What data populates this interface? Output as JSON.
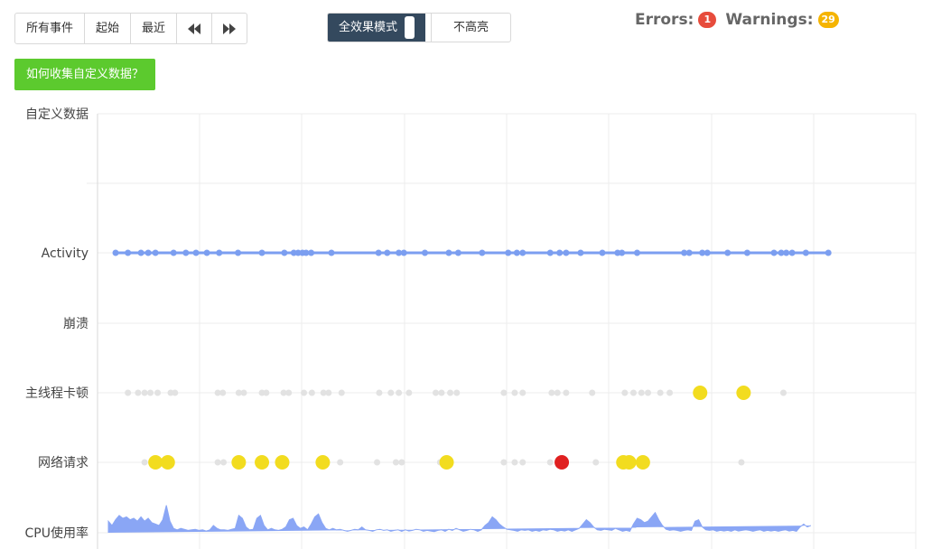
{
  "toolbar": {
    "all_events": "所有事件",
    "start": "起始",
    "recent": "最近",
    "prev_icon": "double-left-icon",
    "next_icon": "double-right-icon"
  },
  "mode_toggle": {
    "on_label": "全效果模式",
    "off_label": "不高亮"
  },
  "status": {
    "errors_label": "Errors:",
    "errors_count": "1",
    "warnings_label": "Warnings:",
    "warnings_count": "29"
  },
  "help_button": "如何收集自定义数据？",
  "colors": {
    "activity": "#7b9ef0",
    "warning": "#f2dc1f",
    "error": "#e02020",
    "muted": "#e2e2e2",
    "cpu": "#8aa6f5"
  },
  "chart_data": {
    "type": "scatter",
    "title": "",
    "rows": [
      "自定义数据",
      "Activity",
      "崩溃",
      "主线程卡顿",
      "网络请求",
      "CPU使用率"
    ],
    "grid": true,
    "xlim": [
      0,
      100
    ],
    "series": [
      {
        "name": "Activity",
        "x": [
          1,
          2.7,
          4.5,
          5.5,
          6.5,
          9,
          10.7,
          12.1,
          13.6,
          15.3,
          17.9,
          21.2,
          24.3,
          25.6,
          26.2,
          26.8,
          27.3,
          28,
          30.8,
          37.3,
          38.5,
          40.1,
          40.8,
          43.7,
          47,
          48.3,
          51.6,
          55.2,
          56.4,
          57.2,
          61,
          62.3,
          63.2,
          65.2,
          68.2,
          70.3,
          70.9,
          73,
          79.5,
          80.2,
          82,
          82.7,
          85.5,
          88.2,
          91.9,
          92.9,
          93.6,
          94.4,
          96.3,
          99.4
        ],
        "y": "Activity"
      },
      {
        "name": "主线程卡顿",
        "x": [
          2.7,
          4.1,
          5,
          5.8,
          6.8,
          8.6,
          9.2,
          15.1,
          15.8,
          18,
          18.7,
          21.2,
          21.8,
          24.2,
          24.9,
          27,
          28.1,
          29.7,
          30.4,
          32.2,
          37.4,
          39,
          40.1,
          41.5,
          45.2,
          46,
          47.2,
          48.1,
          54.6,
          56.1,
          57.2,
          61.2,
          62,
          63.2,
          66.8,
          71.3,
          72.5,
          73.6,
          74.5,
          76.2,
          77.5,
          93.2
        ],
        "highlight_x": [
          81.7,
          87.7
        ],
        "y": "主线程卡顿"
      },
      {
        "name": "网络请求",
        "x": [
          5,
          15.1,
          15.9,
          23.9,
          32,
          37.1,
          39.7,
          40.5,
          45.8,
          54.6,
          56.1,
          57.2,
          61,
          67.3,
          87.4
        ],
        "highlight_x": [
          6.5,
          8.2,
          18,
          21.2,
          24,
          29.6,
          46.7,
          71.1,
          71.9,
          73.8
        ],
        "error_x": [
          62.6
        ],
        "y": "网络请求"
      }
    ],
    "cpu_usage": {
      "name": "CPU使用率",
      "x": [
        0,
        0.5,
        1,
        1.5,
        2,
        2.5,
        3,
        3.5,
        4,
        4.5,
        5,
        5.5,
        6,
        6.5,
        7,
        7.5,
        8,
        8.5,
        9,
        9.5,
        10,
        10.5,
        11,
        11.5,
        12,
        12.5,
        13,
        13.5,
        14,
        14.5,
        15,
        15.5,
        16,
        16.5,
        17,
        17.5,
        18,
        18.5,
        19,
        19.5,
        20,
        20.5,
        21,
        21.5,
        22,
        22.5,
        23,
        23.5,
        24,
        24.5,
        25,
        25.5,
        26,
        26.5,
        27,
        27.5,
        28,
        28.5,
        29,
        29.5,
        30,
        30.5,
        31,
        31.5,
        32,
        32.5,
        33,
        33.5,
        34,
        34.5,
        35,
        35.5,
        36,
        36.5,
        37,
        37.5,
        38,
        38.5,
        39,
        39.5,
        40,
        40.5,
        41,
        41.5,
        42,
        42.5,
        43,
        43.5,
        44,
        44.5,
        45,
        45.5,
        46,
        46.5,
        47,
        47.5,
        48,
        48.5,
        49,
        49.5,
        50,
        50.5,
        51,
        51.5,
        52,
        52.5,
        53,
        53.5,
        54,
        54.5,
        55,
        55.5,
        56,
        56.5,
        57,
        57.5,
        58,
        58.5,
        59,
        59.5,
        60,
        60.5,
        61,
        61.5,
        62,
        62.5,
        63,
        63.5,
        64,
        64.5,
        65,
        65.5,
        66,
        66.5,
        67,
        67.5,
        68,
        68.5,
        69,
        69.5,
        70,
        70.5,
        71,
        71.5,
        72,
        72.5,
        73,
        73.5,
        74,
        74.5,
        75,
        75.5,
        76,
        76.5,
        77,
        77.5,
        78,
        78.5,
        79,
        79.5,
        80,
        80.5,
        81,
        81.5,
        82,
        82.5,
        83,
        83.5,
        84,
        84.5,
        85,
        85.5,
        86,
        86.5,
        87,
        87.5,
        88,
        88.5,
        89,
        89.5,
        90,
        90.5,
        91,
        91.5,
        92,
        92.5,
        93,
        93.5,
        94,
        94.5,
        95,
        95.5,
        96,
        96.5,
        97,
        97.5,
        98,
        98.5,
        99,
        99.5,
        100
      ],
      "y": [
        0.4,
        0.25,
        0.45,
        0.6,
        0.5,
        0.55,
        0.45,
        0.5,
        0.4,
        0.55,
        0.4,
        0.5,
        0.35,
        0.3,
        0.25,
        0.45,
        0.95,
        0.4,
        0.15,
        0.1,
        0.15,
        0.12,
        0.08,
        0.1,
        0.12,
        0.08,
        0.1,
        0.06,
        0.1,
        0.25,
        0.15,
        0.1,
        0.1,
        0.08,
        0.12,
        0.15,
        0.6,
        0.5,
        0.2,
        0.1,
        0.12,
        0.5,
        0.6,
        0.25,
        0.1,
        0.15,
        0.1,
        0.08,
        0.12,
        0.2,
        0.45,
        0.5,
        0.25,
        0.15,
        0.2,
        0.1,
        0.3,
        0.55,
        0.65,
        0.35,
        0.15,
        0.1,
        0.15,
        0.1,
        0.12,
        0.08,
        0.05,
        0.08,
        0.12,
        0.1,
        0.2,
        0.1,
        0.08,
        0.05,
        0.1,
        0.12,
        0.08,
        0.1,
        0.05,
        0.08,
        0.1,
        0.05,
        0.1,
        0.06,
        0.08,
        0.12,
        0.1,
        0.05,
        0.08,
        0.06,
        0.04,
        0.08,
        0.1,
        0.05,
        0.12,
        0.08,
        0.15,
        0.1,
        0.05,
        0.08,
        0.12,
        0.1,
        0.05,
        0.1,
        0.25,
        0.35,
        0.55,
        0.45,
        0.3,
        0.2,
        0.12,
        0.1,
        0.08,
        0.05,
        0.1,
        0.08,
        0.1,
        0.05,
        0.08,
        0.05,
        0.1,
        0.08,
        0.12,
        0.1,
        0.05,
        0.08,
        0.06,
        0.1,
        0.05,
        0.1,
        0.15,
        0.3,
        0.45,
        0.35,
        0.2,
        0.1,
        0.08,
        0.12,
        0.1,
        0.08,
        0.15,
        0.1,
        0.05,
        0.08,
        0.05,
        0.3,
        0.5,
        0.45,
        0.35,
        0.4,
        0.55,
        0.7,
        0.45,
        0.25,
        0.12,
        0.08,
        0.1,
        0.08,
        0.05,
        0.08,
        0.1,
        0.08,
        0.4,
        0.45,
        0.2,
        0.1,
        0.08,
        0.1,
        0.05,
        0.08,
        0.06,
        0.08,
        0.05,
        0.1,
        0.06,
        0.08,
        0.1,
        0.08,
        0.05,
        0.08,
        0.1,
        0.05,
        0.08,
        0.06,
        0.08,
        0.05,
        0.08,
        0.1,
        0.06,
        0.08,
        0.05,
        0.2,
        0.3,
        0.2,
        0.25
      ]
    }
  }
}
